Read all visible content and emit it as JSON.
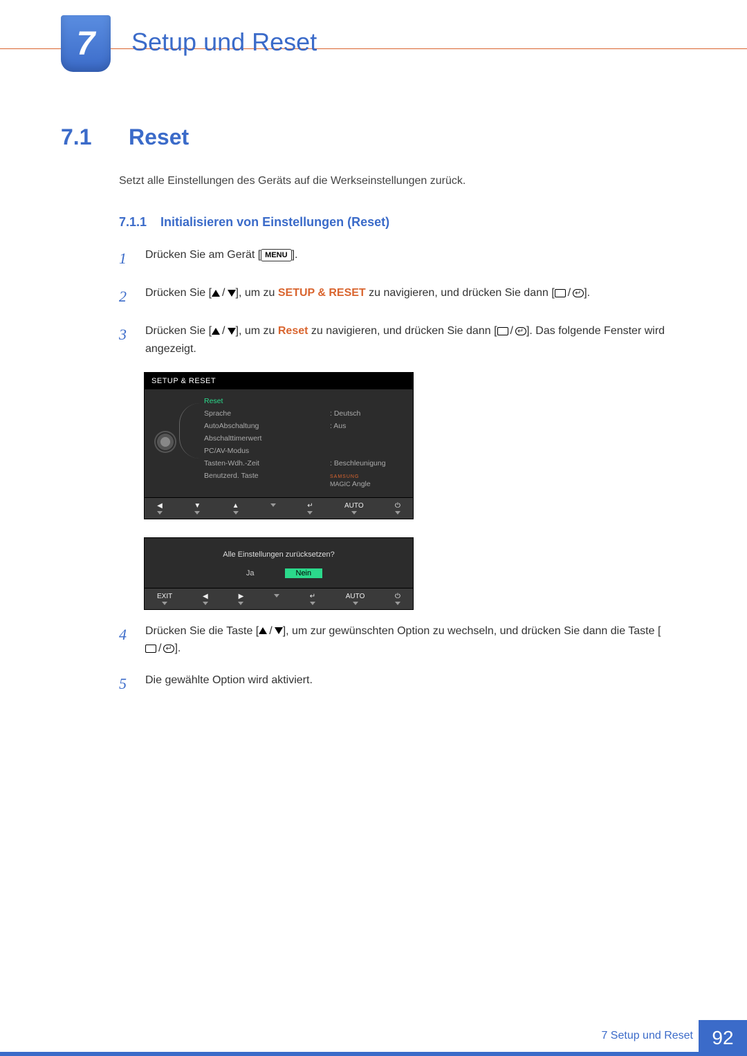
{
  "chapter": {
    "number": "7",
    "title": "Setup und Reset"
  },
  "section": {
    "number": "7.1",
    "title": "Reset"
  },
  "intro": "Setzt alle Einstellungen des Geräts auf die Werkseinstellungen zurück.",
  "subsection": {
    "number": "7.1.1",
    "title": "Initialisieren von Einstellungen (Reset)"
  },
  "steps": {
    "s1": {
      "num": "1",
      "t0": "Drücken Sie am Gerät [",
      "menu": "MENU",
      "t1": "]."
    },
    "s2": {
      "num": "2",
      "t0": "Drücken Sie [",
      "t1": "], um zu ",
      "hl": "SETUP & RESET",
      "t2": " zu navigieren, und drücken Sie dann [",
      "t3": "]."
    },
    "s3": {
      "num": "3",
      "t0": "Drücken Sie [",
      "t1": "], um zu ",
      "hl": "Reset",
      "t2": " zu navigieren, und drücken Sie dann [",
      "t3": "]. Das folgende Fenster wird angezeigt."
    },
    "s4": {
      "num": "4",
      "t0": "Drücken Sie die Taste [",
      "t1": "], um zur gewünschten Option zu wechseln, und drücken Sie dann die Taste [",
      "t2": "]."
    },
    "s5": {
      "num": "5",
      "t": "Die gewählte Option wird aktiviert."
    }
  },
  "osd1": {
    "header": "SETUP & RESET",
    "rows": [
      {
        "label": "Reset",
        "value": "",
        "sel": true
      },
      {
        "label": "Sprache",
        "value": "Deutsch"
      },
      {
        "label": "AutoAbschaltung",
        "value": "Aus"
      },
      {
        "label": "Abschalttimerwert",
        "value": ""
      },
      {
        "label": "PC/AV-Modus",
        "value": ""
      },
      {
        "label": "Tasten-Wdh.-Zeit",
        "value": "Beschleunigung"
      },
      {
        "label": "Benutzerd. Taste",
        "value": "",
        "magic": true
      }
    ],
    "magic_brand": "SAMSUNG",
    "magic_text": "MAGIC",
    "magic_suffix": "Angle",
    "bar": [
      "◀",
      "▼",
      "▲",
      "",
      "↵",
      "AUTO",
      "⏻"
    ]
  },
  "osd2": {
    "prompt": "Alle Einstellungen zurücksetzen?",
    "yes": "Ja",
    "no": "Nein",
    "bar": [
      "EXIT",
      "◀",
      "▶",
      "",
      "↵",
      "AUTO",
      "⏻"
    ]
  },
  "footer": {
    "label": "7 Setup und Reset",
    "page": "92"
  }
}
